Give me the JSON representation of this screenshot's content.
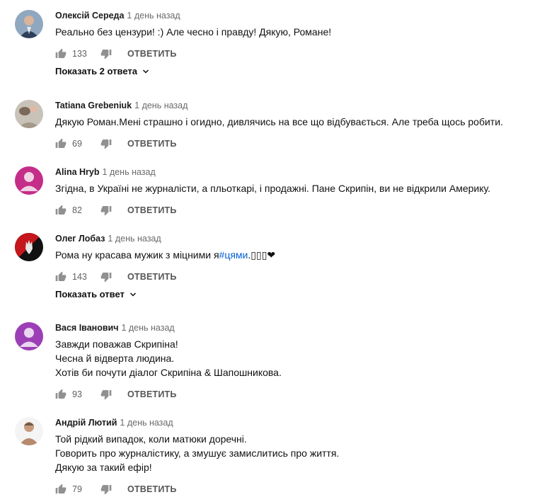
{
  "comments": [
    {
      "author": "Олексій Середа",
      "time": "1 день назад",
      "lines": [
        "Реально без цензури! :) Але чесно і правду! Дякую, Романе!"
      ],
      "likes": "133",
      "reply_label": "ОТВЕТИТЬ",
      "replies_label": "Показать 2 ответа"
    },
    {
      "author": "Tatiana Grebeniuk",
      "time": "1 день назад",
      "lines": [
        "Дякую Роман.Мені страшно і огидно, дивлячись на все що відбувається. Але треба щось робити."
      ],
      "likes": "69",
      "reply_label": "ОТВЕТИТЬ"
    },
    {
      "author": "Alina Hryb",
      "time": "1 день назад",
      "lines": [
        "Згідна, в Україні не журналісти, а пльоткарі, і продажні. Пане Скрипін, ви не відкрили Америку."
      ],
      "likes": "82",
      "reply_label": "ОТВЕТИТЬ"
    },
    {
      "author": "Олег Лобаз",
      "time": "1 день назад",
      "text_before": "Рома ну красава мужик з міцними я",
      "hashtag": "#цями",
      "text_after": ".▯▯▯❤",
      "likes": "143",
      "reply_label": "ОТВЕТИТЬ",
      "replies_label": "Показать ответ"
    },
    {
      "author": "Вася Іванович",
      "time": "1 день назад",
      "lines": [
        "Завжди поважав  Скрипіна!",
        "Чесна й відверта людина.",
        "Хотів би почути діалог Скрипіна &  Шапошникова."
      ],
      "likes": "93",
      "reply_label": "ОТВЕТИТЬ"
    },
    {
      "author": "Андрій Лютий",
      "time": "1 день назад",
      "lines": [
        "Той рідкий випадок, коли матюки доречні.",
        "Говорить про журналістику, а змушує замислитись про життя.",
        "Дякую за такий ефір!"
      ],
      "likes": "79",
      "reply_label": "ОТВЕТИТЬ"
    }
  ],
  "colors": {
    "default_avatar": "#c42d88",
    "hashtag": "#065fd4",
    "meta_gray": "#6b6b6b"
  },
  "icons": [
    "thumbs-up-icon",
    "thumbs-down-icon",
    "chevron-down-icon"
  ]
}
